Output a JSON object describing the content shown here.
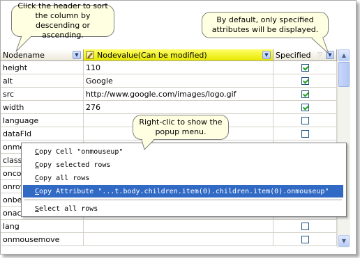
{
  "callouts": {
    "sort": "Click the header to sort the column by descending or ascending.",
    "attributes": "By default, only specified attributes will be displayed.",
    "popup": "Right-clic to show the popup menu."
  },
  "grid": {
    "headers": {
      "name": "Nodename",
      "value": "Nodevalue(Can be modified)",
      "specified": "Specified"
    },
    "rows": [
      {
        "name": "height",
        "value": "110",
        "specified": true
      },
      {
        "name": "alt",
        "value": "Google",
        "specified": true
      },
      {
        "name": "src",
        "value": "http://www.google.com/images/logo.gif",
        "specified": true
      },
      {
        "name": "width",
        "value": "276",
        "specified": true
      },
      {
        "name": "language",
        "value": "",
        "specified": false
      },
      {
        "name": "dataFld",
        "value": "",
        "specified": false
      },
      {
        "name": "onmouseup",
        "value": "",
        "specified": false
      },
      {
        "name": "class",
        "value": "",
        "specified": false
      },
      {
        "name": "oncontextmenu",
        "value": "",
        "specified": false
      },
      {
        "name": "onrowexit",
        "value": "",
        "specified": false
      },
      {
        "name": "onbeforepaste",
        "value": "",
        "specified": false
      },
      {
        "name": "onactivate",
        "value": "",
        "specified": false
      },
      {
        "name": "lang",
        "value": "",
        "specified": false
      },
      {
        "name": "onmousemove",
        "value": "",
        "specified": false
      }
    ]
  },
  "context_menu": {
    "items": [
      {
        "label": "Copy Cell \"onmouseup\"",
        "accel": "C",
        "rest": "opy Cell \"onmouseup\""
      },
      {
        "label": "Copy selected rows",
        "accel": "C",
        "rest": "opy selected rows",
        "u_index": 1
      },
      {
        "label": "Copy all rows",
        "accel": "C",
        "rest": "opy all rows"
      },
      {
        "label": "Copy Attribute \"...t.body.children.item(0).children.item(0).onmouseup\"",
        "accel": "C",
        "rest": "opy Attribute \"...t.body.children.item(0).children.item(0).onmouseup\"",
        "selected": true
      },
      {
        "label": "Select all rows",
        "accel": "S",
        "rest": "elect all rows"
      }
    ]
  }
}
